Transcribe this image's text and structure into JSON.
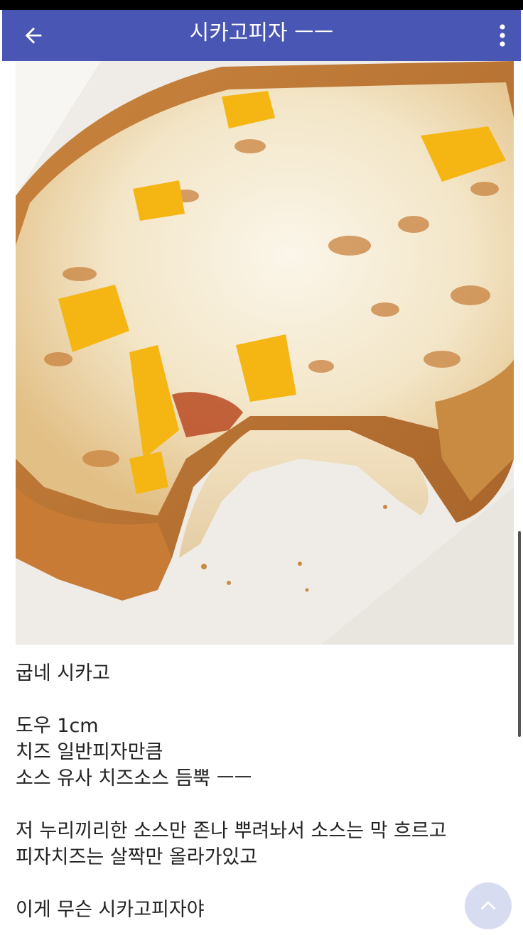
{
  "app_bar": {
    "title": "시카고피자 ㅡㅡ",
    "back_icon": "arrow-left-icon",
    "menu_icon": "more-vert-icon",
    "color": "#4a56b3"
  },
  "photo": {
    "subject": "pizza-photo"
  },
  "post": {
    "lines": [
      "굽네 시카고",
      "",
      "도우 1cm",
      "치즈 일반피자만큼",
      "소스 유사 치즈소스 듬뿍 ㅡㅡ",
      "",
      "저 누리끼리한 소스만 존나 뿌려놔서 소스는 막 흐르고",
      "피자치즈는 살짝만 올라가있고",
      "",
      "이게 무슨 시카고피자야"
    ]
  },
  "scroll_top_button": {
    "icon": "chevron-up-icon"
  }
}
